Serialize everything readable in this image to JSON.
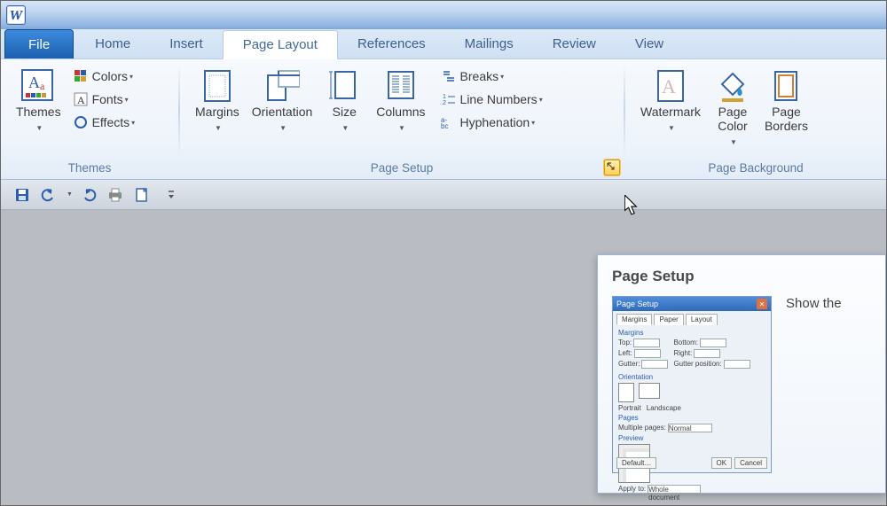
{
  "app": {
    "shortname": "W"
  },
  "tabs": {
    "file": "File",
    "items": [
      "Home",
      "Insert",
      "Page Layout",
      "References",
      "Mailings",
      "Review",
      "View"
    ],
    "active_index": 2
  },
  "ribbon": {
    "groups": [
      {
        "label": "Themes",
        "big": [
          {
            "name": "themes",
            "label": "Themes",
            "drop": true
          }
        ],
        "small": [
          {
            "name": "colors",
            "label": "Colors",
            "drop": true,
            "icon": "colors-icon"
          },
          {
            "name": "fonts",
            "label": "Fonts",
            "drop": true,
            "icon": "fonts-icon"
          },
          {
            "name": "effects",
            "label": "Effects",
            "drop": true,
            "icon": "effects-icon"
          }
        ]
      },
      {
        "label": "Page Setup",
        "big": [
          {
            "name": "margins",
            "label": "Margins",
            "drop": true
          },
          {
            "name": "orientation",
            "label": "Orientation",
            "drop": true
          },
          {
            "name": "size",
            "label": "Size",
            "drop": true
          },
          {
            "name": "columns",
            "label": "Columns",
            "drop": true
          }
        ],
        "small": [
          {
            "name": "breaks",
            "label": "Breaks",
            "drop": true,
            "icon": "breaks-icon"
          },
          {
            "name": "line-numbers",
            "label": "Line Numbers",
            "drop": true,
            "icon": "line-numbers-icon"
          },
          {
            "name": "hyphenation",
            "label": "Hyphenation",
            "drop": true,
            "icon": "hyphenation-icon"
          }
        ],
        "launcher": true,
        "launcher_highlight": true
      },
      {
        "label": "Page Background",
        "big": [
          {
            "name": "watermark",
            "label": "Watermark",
            "drop": true
          },
          {
            "name": "page-color",
            "label": "Page\nColor",
            "drop": true
          },
          {
            "name": "page-borders",
            "label": "Page\nBorders",
            "drop": false
          }
        ]
      }
    ]
  },
  "qat": [
    "save",
    "undo",
    "redo",
    "print",
    "new"
  ],
  "tooltip": {
    "title": "Page Setup",
    "desc": "Show the",
    "preview": {
      "title": "Page Setup",
      "tabs": [
        "Margins",
        "Paper",
        "Layout"
      ],
      "section1": "Margins",
      "fields_left": [
        "Top:",
        "Left:",
        "Gutter:"
      ],
      "fields_right": [
        "Bottom:",
        "Right:",
        "Gutter position:"
      ],
      "section2": "Orientation",
      "orient": [
        "Portrait",
        "Landscape"
      ],
      "section3": "Pages",
      "multi_label": "Multiple pages:",
      "multi_value": "Normal",
      "section4": "Preview",
      "apply_label": "Apply to:",
      "apply_value": "Whole document",
      "buttons": [
        "Default…",
        "OK",
        "Cancel"
      ]
    }
  }
}
